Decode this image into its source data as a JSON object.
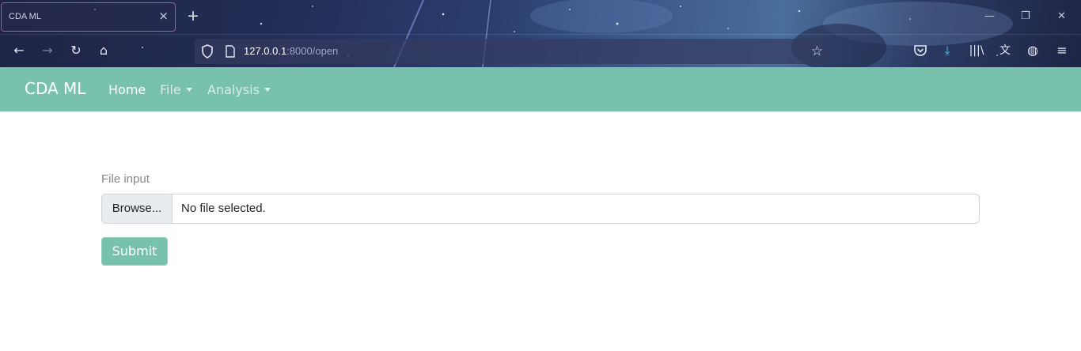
{
  "browser": {
    "tab_title": "CDA ML",
    "tab_close_icon": "close-icon",
    "new_tab_icon": "plus-icon",
    "url_host": "127.0.0.1",
    "url_rest": ":8000/open",
    "toolbar_icons": [
      "back-arrow-icon",
      "forward-arrow-icon",
      "reload-icon",
      "home-icon",
      "shield-icon",
      "page-icon",
      "star-icon",
      "pocket-icon",
      "download-icon",
      "library-icon",
      "translate-icon",
      "globe-icon",
      "menu-icon"
    ],
    "window_controls": [
      "minimize-icon",
      "restore-icon",
      "close-icon"
    ]
  },
  "navbar": {
    "brand": "CDA ML",
    "home": "Home",
    "file": "File",
    "analysis": "Analysis",
    "bg_color": "#78c2ad"
  },
  "form": {
    "label": "File input",
    "browse": "Browse...",
    "status": "No file selected.",
    "submit": "Submit"
  }
}
